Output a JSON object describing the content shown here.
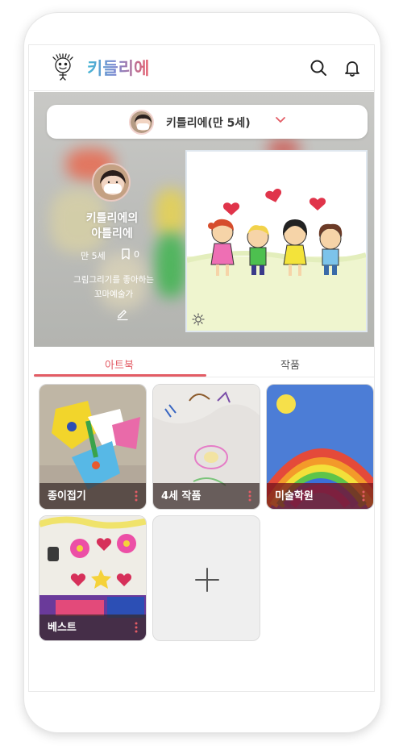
{
  "app": {
    "title": "키들리에"
  },
  "header": {
    "search_icon": "search-icon",
    "notification_icon": "bell-icon"
  },
  "child_selector": {
    "label": "키틀리에(만 5세)",
    "icon": "chevron-down-icon"
  },
  "profile": {
    "name_line1": "키틀리에의",
    "name_line2": "아틀리에",
    "age": "만 5세",
    "bookmark_count": "0",
    "bio_line1": "그림그리기를 좋아하는",
    "bio_line2": "꼬마예술가"
  },
  "tabs": [
    {
      "label": "아트북",
      "active": true
    },
    {
      "label": "작품",
      "active": false
    }
  ],
  "albums": [
    {
      "label": "종이접기"
    },
    {
      "label": "4세 작품"
    },
    {
      "label": "미술학원"
    },
    {
      "label": "베스트"
    }
  ],
  "colors": {
    "accent": "#e35c65",
    "title_start": "#44b6d4",
    "title_end": "#e85f6c"
  }
}
